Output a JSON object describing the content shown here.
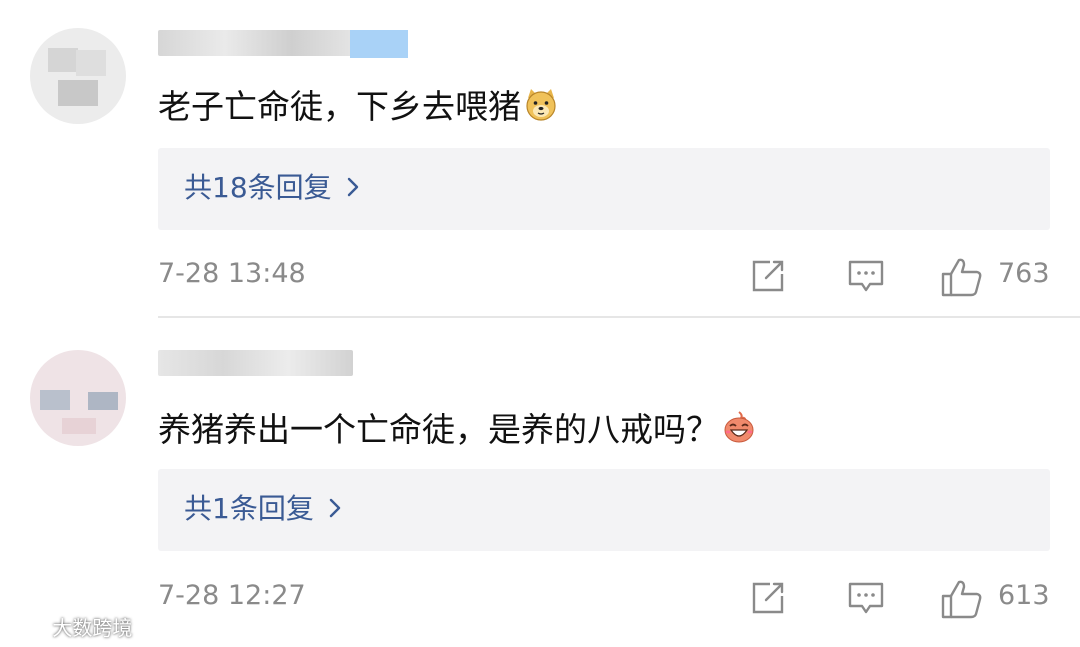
{
  "comments": [
    {
      "text": "老子亡命徒，下乡去喂猪",
      "emoji": "doge-emoji",
      "reply_label": "共18条回复",
      "timestamp": "7-28 13:48",
      "likes": "763"
    },
    {
      "text": "养猪养出一个亡命徒，是养的八戒吗？",
      "emoji": "laughing-emoji",
      "reply_label": "共1条回复",
      "timestamp": "7-28 12:27",
      "likes": "613"
    }
  ],
  "watermark": {
    "text": "大数跨境"
  },
  "colors": {
    "reply_link": "#3a5a94",
    "meta_text": "#8a8a8a",
    "reply_bg": "#f3f3f5",
    "divider": "#e6e6e6"
  }
}
